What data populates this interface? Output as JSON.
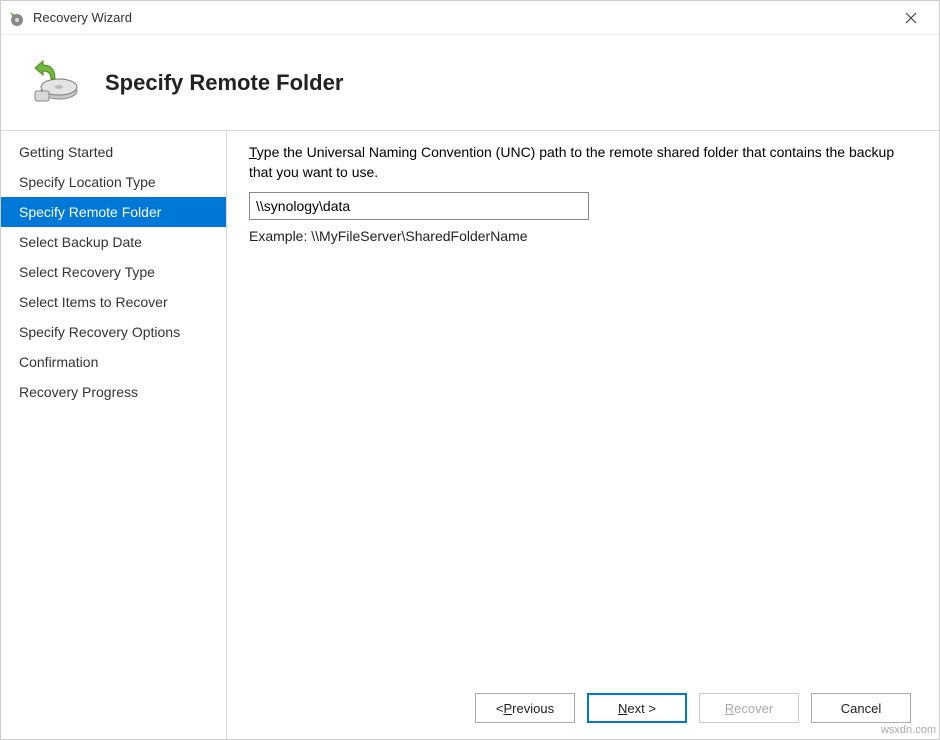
{
  "window": {
    "title": "Recovery Wizard"
  },
  "header": {
    "heading": "Specify Remote Folder"
  },
  "sidebar": {
    "steps": [
      {
        "label": "Getting Started",
        "active": false
      },
      {
        "label": "Specify Location Type",
        "active": false
      },
      {
        "label": "Specify Remote Folder",
        "active": true
      },
      {
        "label": "Select Backup Date",
        "active": false
      },
      {
        "label": "Select Recovery Type",
        "active": false
      },
      {
        "label": "Select Items to Recover",
        "active": false
      },
      {
        "label": "Specify Recovery Options",
        "active": false
      },
      {
        "label": "Confirmation",
        "active": false
      },
      {
        "label": "Recovery Progress",
        "active": false
      }
    ]
  },
  "content": {
    "instruction_prefix_letter": "T",
    "instruction_rest": "ype the Universal Naming Convention (UNC) path to the remote shared folder that contains the backup that you want to use.",
    "path_value": "\\\\synology\\data",
    "example": "Example: \\\\MyFileServer\\SharedFolderName"
  },
  "buttons": {
    "previous": "< Previous",
    "next": "Next >",
    "recover": "Recover",
    "cancel": "Cancel"
  },
  "watermark": "wsxdn.com"
}
